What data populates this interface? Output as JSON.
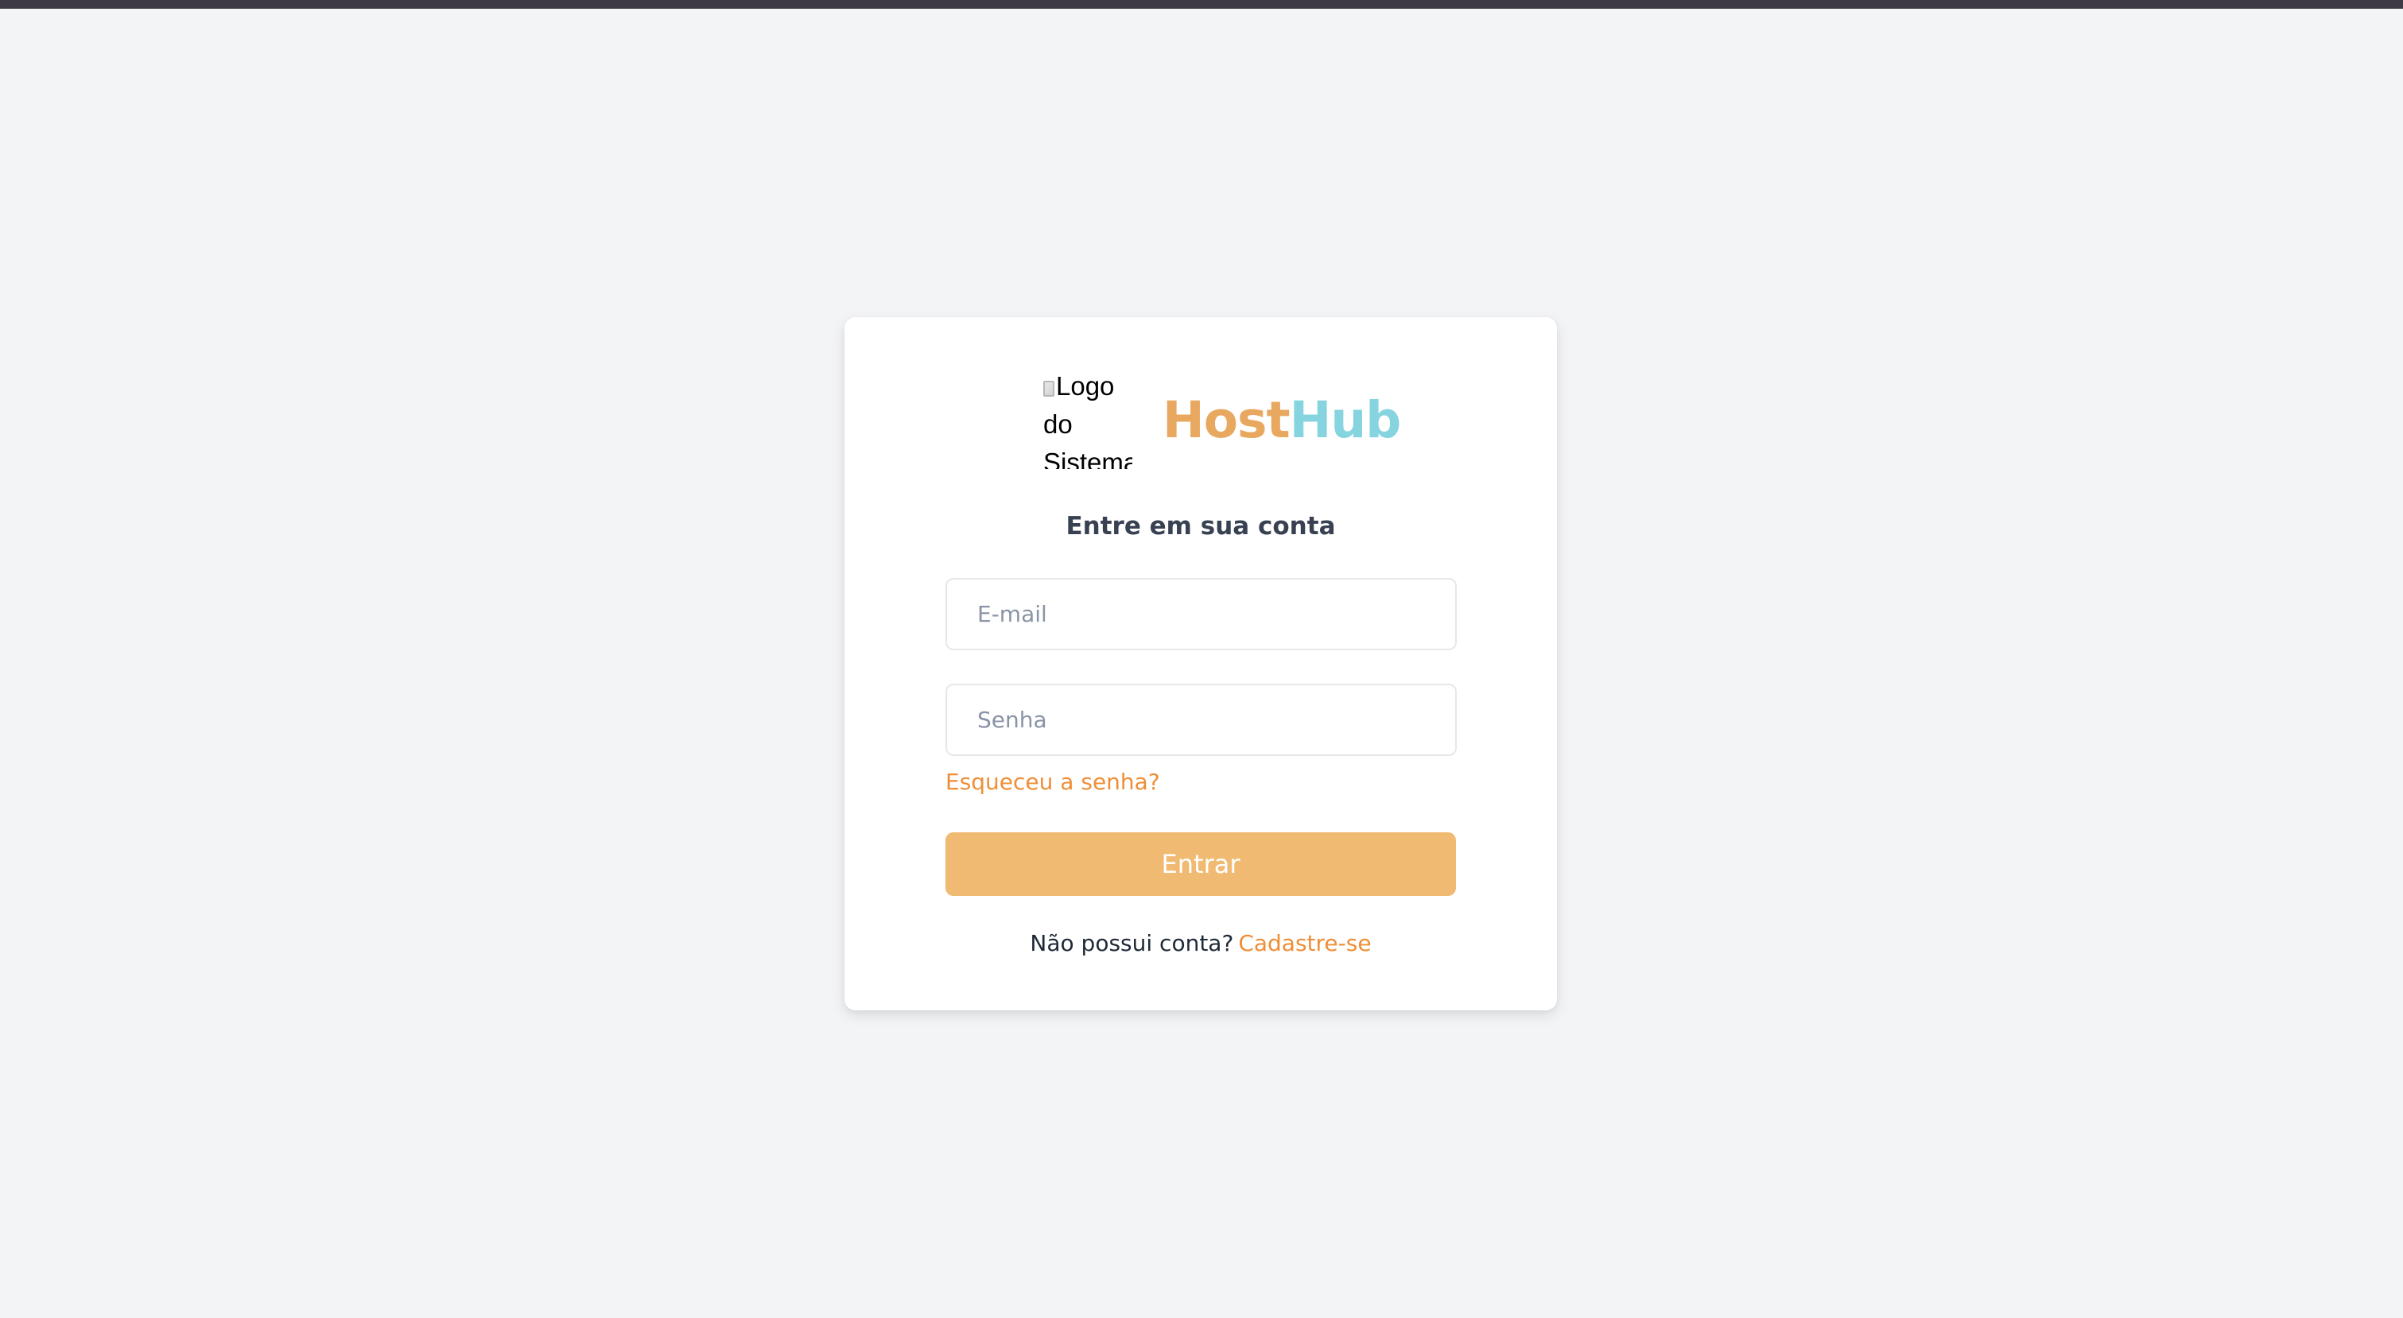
{
  "login": {
    "logo_alt": "Logo do Sistema",
    "brand": {
      "part1": "Host",
      "part2": "Hub"
    },
    "heading": "Entre em sua conta",
    "email": {
      "placeholder": "E-mail",
      "value": ""
    },
    "password": {
      "placeholder": "Senha",
      "value": ""
    },
    "forgot_label": "Esqueceu a senha?",
    "submit_label": "Entrar",
    "signup_prompt": "Não possui conta?",
    "signup_link": "Cadastre-se"
  },
  "colors": {
    "page_background": "#f3f4f6",
    "card_background": "#ffffff",
    "accent_orange": "#ef8e37",
    "button_background": "#f1ba72",
    "brand_host": "#e9a860",
    "brand_hub": "#86d4e0",
    "heading_text": "#374151"
  }
}
